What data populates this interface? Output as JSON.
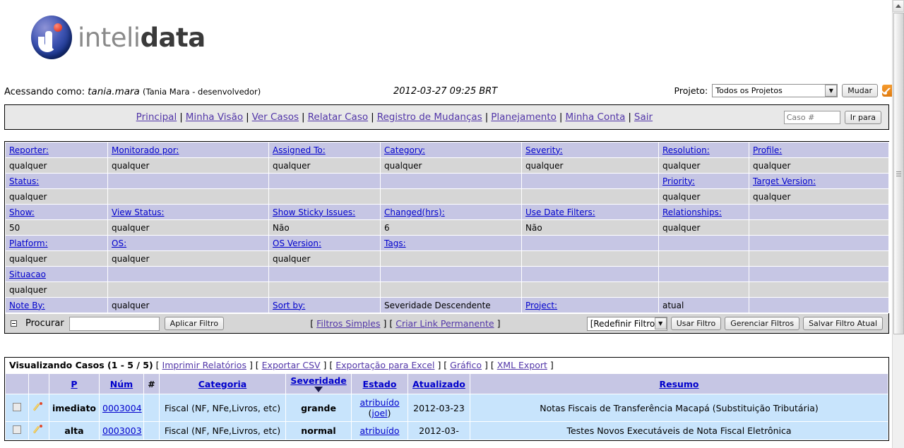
{
  "brand": {
    "text_light": "inteli",
    "text_bold": "data"
  },
  "header": {
    "access_prefix": "Acessando como:",
    "username": "tania.mara",
    "realname": "(Tania Mara - desenvolvedor)",
    "timestamp": "2012-03-27 09:25 BRT",
    "project_label": "Projeto:",
    "project_selected": "Todos os Projetos",
    "change_button": "Mudar",
    "rss_icon": "rss-icon"
  },
  "nav": {
    "links": [
      "Principal",
      "Minha Visão",
      "Ver Casos",
      "Relatar Caso",
      "Registro de Mudanças",
      "Planejamento",
      "Minha Conta",
      "Sair"
    ],
    "separator": "|",
    "case_placeholder": "Caso #",
    "goto_button": "Ir para"
  },
  "filters": {
    "rows": [
      {
        "type": "hdr",
        "cells": [
          {
            "text": "Reporter:",
            "link": true
          },
          {
            "text": "Monitorado por:",
            "link": true
          },
          {
            "text": "Assigned To:",
            "link": true
          },
          {
            "text": "Category:",
            "link": true
          },
          {
            "text": "Severity:",
            "link": true
          },
          {
            "text": "Resolution:",
            "link": true
          },
          {
            "text": "Profile:",
            "link": true
          }
        ]
      },
      {
        "type": "val",
        "cells": [
          {
            "text": "qualquer"
          },
          {
            "text": "qualquer"
          },
          {
            "text": "qualquer"
          },
          {
            "text": "qualquer"
          },
          {
            "text": "qualquer"
          },
          {
            "text": "qualquer"
          },
          {
            "text": "qualquer"
          }
        ]
      },
      {
        "type": "hdr",
        "cells": [
          {
            "text": "Status:",
            "link": true
          },
          {
            "text": ""
          },
          {
            "text": ""
          },
          {
            "text": ""
          },
          {
            "text": ""
          },
          {
            "text": "Priority:",
            "link": true
          },
          {
            "text": "Target Version:",
            "link": true
          }
        ]
      },
      {
        "type": "val",
        "cells": [
          {
            "text": "qualquer"
          },
          {
            "text": ""
          },
          {
            "text": ""
          },
          {
            "text": ""
          },
          {
            "text": ""
          },
          {
            "text": "qualquer"
          },
          {
            "text": "qualquer"
          }
        ]
      },
      {
        "type": "hdr",
        "cells": [
          {
            "text": "Show:",
            "link": true
          },
          {
            "text": "View Status:",
            "link": true
          },
          {
            "text": "Show Sticky Issues:",
            "link": true
          },
          {
            "text": "Changed(hrs):",
            "link": true
          },
          {
            "text": "Use Date Filters:",
            "link": true
          },
          {
            "text": "Relationships:",
            "link": true
          },
          {
            "text": ""
          }
        ]
      },
      {
        "type": "val",
        "cells": [
          {
            "text": "50"
          },
          {
            "text": "qualquer"
          },
          {
            "text": "Não"
          },
          {
            "text": "6"
          },
          {
            "text": "Não"
          },
          {
            "text": "qualquer"
          },
          {
            "text": ""
          }
        ]
      },
      {
        "type": "hdr",
        "cells": [
          {
            "text": "Platform:",
            "link": true
          },
          {
            "text": "OS:",
            "link": true
          },
          {
            "text": "OS Version:",
            "link": true
          },
          {
            "text": "Tags:",
            "link": true
          },
          {
            "text": ""
          },
          {
            "text": ""
          },
          {
            "text": ""
          }
        ]
      },
      {
        "type": "val",
        "cells": [
          {
            "text": "qualquer"
          },
          {
            "text": "qualquer"
          },
          {
            "text": "qualquer"
          },
          {
            "text": ""
          },
          {
            "text": ""
          },
          {
            "text": ""
          },
          {
            "text": ""
          }
        ]
      },
      {
        "type": "hdr",
        "cells": [
          {
            "text": "Situacao",
            "link": true
          },
          {
            "text": ""
          },
          {
            "text": ""
          },
          {
            "text": ""
          },
          {
            "text": ""
          },
          {
            "text": ""
          },
          {
            "text": ""
          }
        ]
      },
      {
        "type": "val",
        "cells": [
          {
            "text": "qualquer"
          },
          {
            "text": ""
          },
          {
            "text": ""
          },
          {
            "text": ""
          },
          {
            "text": ""
          },
          {
            "text": ""
          },
          {
            "text": ""
          }
        ]
      },
      {
        "type": "hdr",
        "cells": [
          {
            "text": "Note By:",
            "link": true
          },
          {
            "text": "qualquer",
            "plain": true
          },
          {
            "text": "Sort by:",
            "link": true
          },
          {
            "text": "Severidade Descendente",
            "plain": true
          },
          {
            "text": "Project:",
            "link": true
          },
          {
            "text": "atual",
            "plain": true
          },
          {
            "text": ""
          }
        ]
      }
    ],
    "actions": {
      "search_label": "Procurar",
      "search_value": "",
      "apply_button": "Aplicar Filtro",
      "simple_filters_link": "Filtros Simples",
      "permalink_link": "Criar Link Permanente",
      "bracket_open": "[",
      "bracket_close": "]",
      "filter_select": "[Redefinir Filtro]",
      "use_filter_button": "Usar Filtro",
      "manage_filters_button": "Gerenciar Filtros",
      "save_filter_button": "Salvar Filtro Atual"
    }
  },
  "cases": {
    "title": "Visualizando Casos (1 - 5 / 5)",
    "export_links": [
      "Imprimir Relatórios",
      "Exportar CSV",
      "Exportação para Excel",
      "Gráfico",
      "XML Export"
    ],
    "columns": [
      "",
      "",
      "P",
      "Núm",
      "#",
      "Categoria",
      "Severidade",
      "Estado",
      "Atualizado",
      "Resumo"
    ],
    "sorted_column": "Severidade",
    "sort_direction": "desc",
    "rows": [
      {
        "priority": "imediato",
        "number": "0003004",
        "count": "",
        "category": "Fiscal (NF, NFe,Livros, etc)",
        "severity": "grande",
        "state": "atribuído",
        "assignee": "(joel)",
        "assignee_name": "joel",
        "updated": "2012-03-23",
        "summary": "Notas Fiscais de Transferência Macapá (Substituição Tributária)"
      },
      {
        "priority": "alta",
        "number": "0003003",
        "count": "",
        "category": "Fiscal (NF, NFe,Livros, etc)",
        "severity": "normal",
        "state": "atribuído",
        "assignee": "",
        "assignee_name": "",
        "updated": "2012-03-",
        "summary": "Testes Novos Executáveis de Nota Fiscal Eletrônica"
      }
    ]
  },
  "scrollbar": {
    "up_icon": "scroll-up-arrow",
    "thumb": "scroll-thumb"
  }
}
